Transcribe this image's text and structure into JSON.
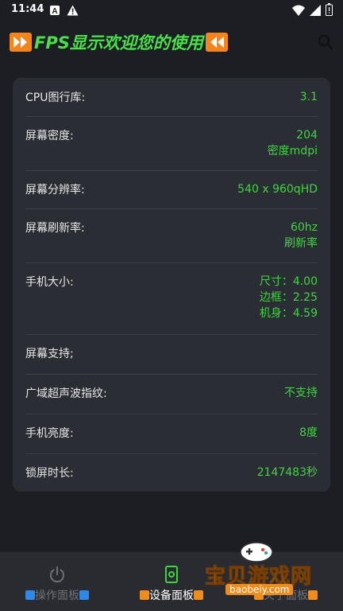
{
  "status_bar": {
    "time": "11:44"
  },
  "app_bar": {
    "title": "FPS显示欢迎您的使用"
  },
  "info_rows": [
    {
      "label": "CPU图行库:",
      "value": [
        "3.1"
      ]
    },
    {
      "label": "屏幕密度:",
      "value": [
        "204",
        "密度mdpi"
      ]
    },
    {
      "label": "屏幕分辨率:",
      "value": [
        "540 x 960qHD"
      ]
    },
    {
      "label": "屏幕刷新率:",
      "value": [
        "60hz",
        "刷新率"
      ]
    },
    {
      "label": "手机大小:",
      "value": [
        "尺寸：4.00",
        "边框：2.25",
        "机身：4.59"
      ]
    },
    {
      "label": "屏幕支持;",
      "value": []
    },
    {
      "label": "广域超声波指纹:",
      "value": [
        "不支持"
      ]
    },
    {
      "label": "手机亮度:",
      "value": [
        "8度"
      ]
    },
    {
      "label": "锁屏时长:",
      "value": [
        "2147483秒"
      ]
    }
  ],
  "bottom_nav": {
    "items": [
      {
        "label": "操作面板"
      },
      {
        "label": "设备面板"
      },
      {
        "label": "关于面板"
      }
    ]
  },
  "watermark": {
    "text": "宝贝游戏网",
    "url": "baobeiy.com"
  },
  "colors": {
    "accent_green": "#3ed63e",
    "title_green": "#4ae04a",
    "orange": "#f4851c",
    "card_bg": "#2a2d34"
  }
}
